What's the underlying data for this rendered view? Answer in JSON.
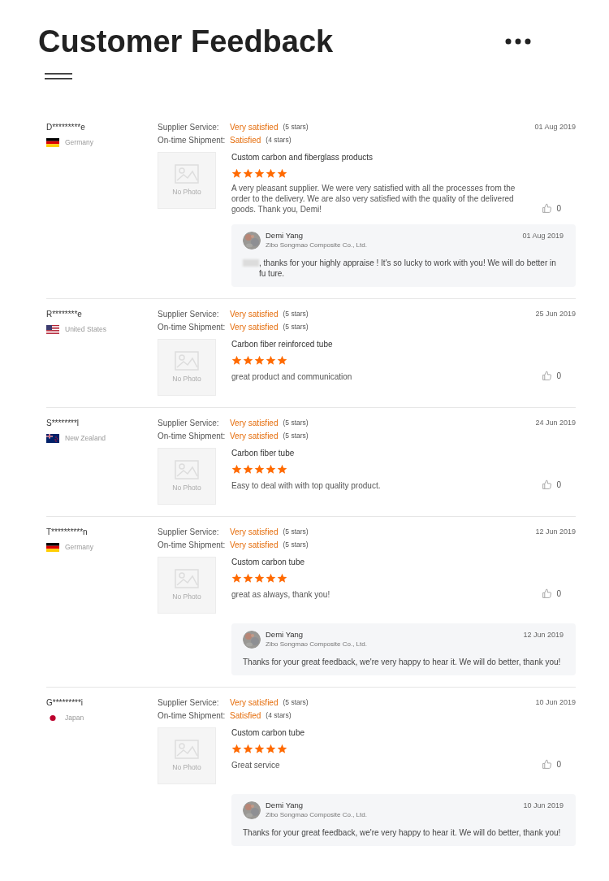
{
  "title": "Customer Feedback",
  "reviews": [
    {
      "name": "D*********e",
      "country": "Germany",
      "kind": "de",
      "date": "01 Aug 2019",
      "ratings": [
        {
          "label": "Supplier Service:",
          "value": "Very satisfied",
          "count": "(5 stars)"
        },
        {
          "label": "On-time Shipment:",
          "value": "Satisfied",
          "count": "(4 stars)"
        }
      ],
      "photo": "No Photo",
      "product": "Custom carbon and fiberglass products",
      "stars": 5,
      "text": "A very pleasant supplier. We were very satisfied with all the processes from the order to the delivery. We are also very satisfied with the quality of the delivered goods. Thank you, Demi!",
      "likes": "0",
      "reply": {
        "name": "Demi Yang",
        "company": "Zibo Songmao Composite Co., Ltd.",
        "date": "01 Aug 2019",
        "blurred_name": true,
        "text": ", thanks for your highly appraise ! It's so lucky to work with you! We will do better in fu ture."
      }
    },
    {
      "name": "R********e",
      "country": "United States",
      "kind": "us",
      "date": "25 Jun 2019",
      "ratings": [
        {
          "label": "Supplier Service:",
          "value": "Very satisfied",
          "count": "(5 stars)"
        },
        {
          "label": "On-time Shipment:",
          "value": "Very satisfied",
          "count": "(5 stars)"
        }
      ],
      "photo": "No Photo",
      "product": "Carbon fiber reinforced tube",
      "stars": 5,
      "text": "great product and communication",
      "likes": "0"
    },
    {
      "name": "S********l",
      "country": "New Zealand",
      "kind": "nz",
      "date": "24 Jun 2019",
      "ratings": [
        {
          "label": "Supplier Service:",
          "value": "Very satisfied",
          "count": "(5 stars)"
        },
        {
          "label": "On-time Shipment:",
          "value": "Very satisfied",
          "count": "(5 stars)"
        }
      ],
      "photo": "No Photo",
      "product": "Carbon fiber tube",
      "stars": 5,
      "text": "Easy to deal with with top quality product.",
      "likes": "0"
    },
    {
      "name": "T**********n",
      "country": "Germany",
      "kind": "de",
      "date": "12 Jun 2019",
      "ratings": [
        {
          "label": "Supplier Service:",
          "value": "Very satisfied",
          "count": "(5 stars)"
        },
        {
          "label": "On-time Shipment:",
          "value": "Very satisfied",
          "count": "(5 stars)"
        }
      ],
      "photo": "No Photo",
      "product": "Custom carbon tube",
      "stars": 5,
      "text": "great as always, thank you!",
      "likes": "0",
      "reply": {
        "name": "Demi Yang",
        "company": "Zibo Songmao Composite Co., Ltd.",
        "date": "12 Jun 2019",
        "blurred_name": false,
        "text": "Thanks for your great feedback, we're very happy to hear it. We will do better, thank you!"
      }
    },
    {
      "name": "G*********i",
      "country": "Japan",
      "kind": "jp",
      "date": "10 Jun 2019",
      "ratings": [
        {
          "label": "Supplier Service:",
          "value": "Very satisfied",
          "count": "(5 stars)"
        },
        {
          "label": "On-time Shipment:",
          "value": "Satisfied",
          "count": "(4 stars)"
        }
      ],
      "photo": "No Photo",
      "product": "Custom carbon tube",
      "stars": 5,
      "text": "Great service",
      "likes": "0",
      "reply": {
        "name": "Demi Yang",
        "company": "Zibo Songmao Composite Co., Ltd.",
        "date": "10 Jun 2019",
        "blurred_name": false,
        "text": "Thanks for your great feedback, we're very happy to hear it. We will do better, thank you!"
      }
    }
  ]
}
